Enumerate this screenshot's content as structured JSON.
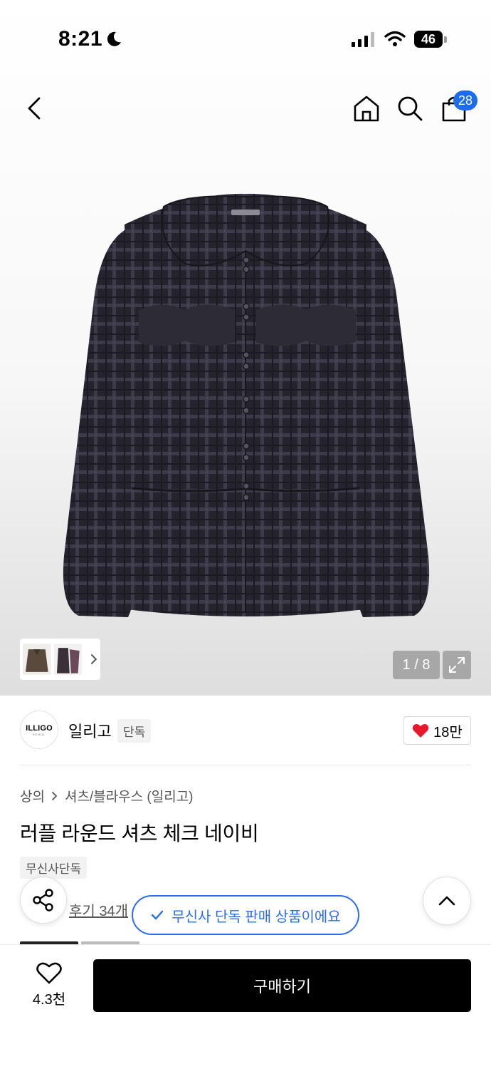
{
  "status_bar": {
    "time": "8:21",
    "battery": "46"
  },
  "nav": {
    "back_icon": "chevron-left-icon",
    "home_icon": "home-icon",
    "search_icon": "search-icon",
    "cart_icon": "shopping-bag-icon",
    "cart_count": "28"
  },
  "gallery": {
    "counter": "1 / 8"
  },
  "brand": {
    "logo_text": "ILLIGO",
    "logo_sub": "SEOUL",
    "name": "일리고",
    "tag": "단독",
    "likes": "18만"
  },
  "breadcrumb": {
    "level1": "상의",
    "level2": "셔츠/블라우스 (일리고)"
  },
  "product": {
    "title": "러플 라운드 셔츠 체크 네이비",
    "chip": "무신사단독",
    "review": "후기 34개"
  },
  "toast": {
    "text": "무신사 단독 판매 상품이에요"
  },
  "bottom": {
    "wish_count": "4.3천",
    "buy_label": "구매하기"
  },
  "colors": {
    "accent_blue": "#2b6cf0",
    "badge_blue": "#1d6cf0",
    "heart_red": "#e8192c",
    "buy_bg": "#000000"
  }
}
